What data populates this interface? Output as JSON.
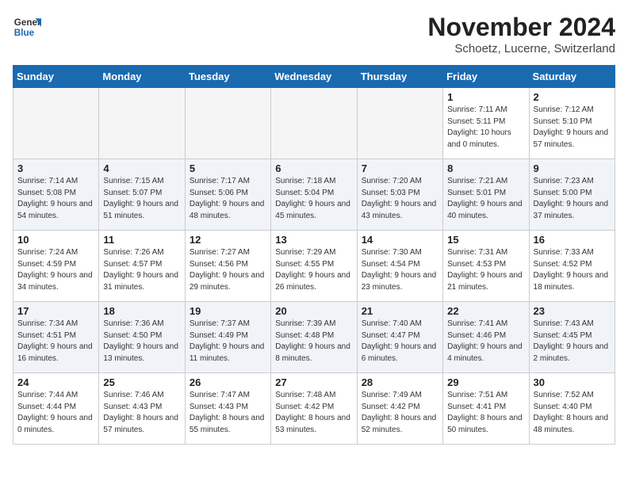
{
  "header": {
    "logo_line1": "General",
    "logo_line2": "Blue",
    "month_year": "November 2024",
    "location": "Schoetz, Lucerne, Switzerland"
  },
  "weekdays": [
    "Sunday",
    "Monday",
    "Tuesday",
    "Wednesday",
    "Thursday",
    "Friday",
    "Saturday"
  ],
  "weeks": [
    [
      {
        "day": "",
        "info": ""
      },
      {
        "day": "",
        "info": ""
      },
      {
        "day": "",
        "info": ""
      },
      {
        "day": "",
        "info": ""
      },
      {
        "day": "",
        "info": ""
      },
      {
        "day": "1",
        "info": "Sunrise: 7:11 AM\nSunset: 5:11 PM\nDaylight: 10 hours and 0 minutes."
      },
      {
        "day": "2",
        "info": "Sunrise: 7:12 AM\nSunset: 5:10 PM\nDaylight: 9 hours and 57 minutes."
      }
    ],
    [
      {
        "day": "3",
        "info": "Sunrise: 7:14 AM\nSunset: 5:08 PM\nDaylight: 9 hours and 54 minutes."
      },
      {
        "day": "4",
        "info": "Sunrise: 7:15 AM\nSunset: 5:07 PM\nDaylight: 9 hours and 51 minutes."
      },
      {
        "day": "5",
        "info": "Sunrise: 7:17 AM\nSunset: 5:06 PM\nDaylight: 9 hours and 48 minutes."
      },
      {
        "day": "6",
        "info": "Sunrise: 7:18 AM\nSunset: 5:04 PM\nDaylight: 9 hours and 45 minutes."
      },
      {
        "day": "7",
        "info": "Sunrise: 7:20 AM\nSunset: 5:03 PM\nDaylight: 9 hours and 43 minutes."
      },
      {
        "day": "8",
        "info": "Sunrise: 7:21 AM\nSunset: 5:01 PM\nDaylight: 9 hours and 40 minutes."
      },
      {
        "day": "9",
        "info": "Sunrise: 7:23 AM\nSunset: 5:00 PM\nDaylight: 9 hours and 37 minutes."
      }
    ],
    [
      {
        "day": "10",
        "info": "Sunrise: 7:24 AM\nSunset: 4:59 PM\nDaylight: 9 hours and 34 minutes."
      },
      {
        "day": "11",
        "info": "Sunrise: 7:26 AM\nSunset: 4:57 PM\nDaylight: 9 hours and 31 minutes."
      },
      {
        "day": "12",
        "info": "Sunrise: 7:27 AM\nSunset: 4:56 PM\nDaylight: 9 hours and 29 minutes."
      },
      {
        "day": "13",
        "info": "Sunrise: 7:29 AM\nSunset: 4:55 PM\nDaylight: 9 hours and 26 minutes."
      },
      {
        "day": "14",
        "info": "Sunrise: 7:30 AM\nSunset: 4:54 PM\nDaylight: 9 hours and 23 minutes."
      },
      {
        "day": "15",
        "info": "Sunrise: 7:31 AM\nSunset: 4:53 PM\nDaylight: 9 hours and 21 minutes."
      },
      {
        "day": "16",
        "info": "Sunrise: 7:33 AM\nSunset: 4:52 PM\nDaylight: 9 hours and 18 minutes."
      }
    ],
    [
      {
        "day": "17",
        "info": "Sunrise: 7:34 AM\nSunset: 4:51 PM\nDaylight: 9 hours and 16 minutes."
      },
      {
        "day": "18",
        "info": "Sunrise: 7:36 AM\nSunset: 4:50 PM\nDaylight: 9 hours and 13 minutes."
      },
      {
        "day": "19",
        "info": "Sunrise: 7:37 AM\nSunset: 4:49 PM\nDaylight: 9 hours and 11 minutes."
      },
      {
        "day": "20",
        "info": "Sunrise: 7:39 AM\nSunset: 4:48 PM\nDaylight: 9 hours and 8 minutes."
      },
      {
        "day": "21",
        "info": "Sunrise: 7:40 AM\nSunset: 4:47 PM\nDaylight: 9 hours and 6 minutes."
      },
      {
        "day": "22",
        "info": "Sunrise: 7:41 AM\nSunset: 4:46 PM\nDaylight: 9 hours and 4 minutes."
      },
      {
        "day": "23",
        "info": "Sunrise: 7:43 AM\nSunset: 4:45 PM\nDaylight: 9 hours and 2 minutes."
      }
    ],
    [
      {
        "day": "24",
        "info": "Sunrise: 7:44 AM\nSunset: 4:44 PM\nDaylight: 9 hours and 0 minutes."
      },
      {
        "day": "25",
        "info": "Sunrise: 7:46 AM\nSunset: 4:43 PM\nDaylight: 8 hours and 57 minutes."
      },
      {
        "day": "26",
        "info": "Sunrise: 7:47 AM\nSunset: 4:43 PM\nDaylight: 8 hours and 55 minutes."
      },
      {
        "day": "27",
        "info": "Sunrise: 7:48 AM\nSunset: 4:42 PM\nDaylight: 8 hours and 53 minutes."
      },
      {
        "day": "28",
        "info": "Sunrise: 7:49 AM\nSunset: 4:42 PM\nDaylight: 8 hours and 52 minutes."
      },
      {
        "day": "29",
        "info": "Sunrise: 7:51 AM\nSunset: 4:41 PM\nDaylight: 8 hours and 50 minutes."
      },
      {
        "day": "30",
        "info": "Sunrise: 7:52 AM\nSunset: 4:40 PM\nDaylight: 8 hours and 48 minutes."
      }
    ]
  ]
}
